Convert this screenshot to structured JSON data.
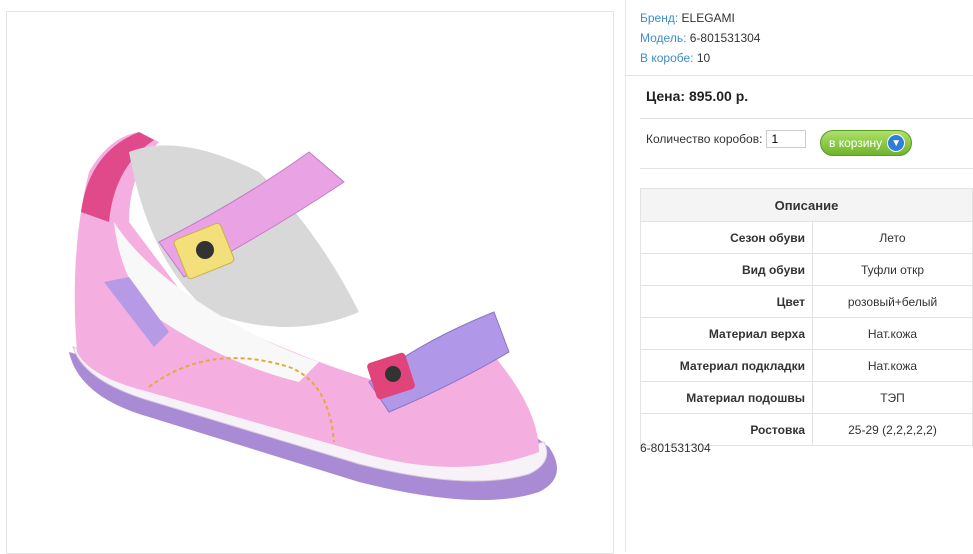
{
  "product": {
    "brand_label": "Бренд:",
    "brand": "ELEGAMI",
    "model_label": "Модель:",
    "model": "6-801531304",
    "box_label": "В коробе:",
    "box_count": "10",
    "price": "Цена: 895.00 р.",
    "qty_label": "Количество коробов:",
    "qty_value": "1",
    "cart_button": "в корзину",
    "article": "6-801531304"
  },
  "description": {
    "header": "Описание",
    "rows": [
      {
        "key": "Сезон обуви",
        "value": "Лето"
      },
      {
        "key": "Вид обуви",
        "value": "Туфли откр"
      },
      {
        "key": "Цвет",
        "value": "розовый+белый"
      },
      {
        "key": "Материал верха",
        "value": "Нат.кожа"
      },
      {
        "key": "Материал подкладки",
        "value": "Нат.кожа"
      },
      {
        "key": "Материал подошвы",
        "value": "ТЭП"
      },
      {
        "key": "Ростовка",
        "value": "25-29 (2,2,2,2,2)"
      }
    ]
  },
  "colors": {
    "link": "#3a8fc9",
    "cart_button": "#7fc23a",
    "shoe_pink": "#f0a7d8",
    "shoe_purple": "#a88ad8"
  },
  "icons": [
    "cart-icon"
  ]
}
